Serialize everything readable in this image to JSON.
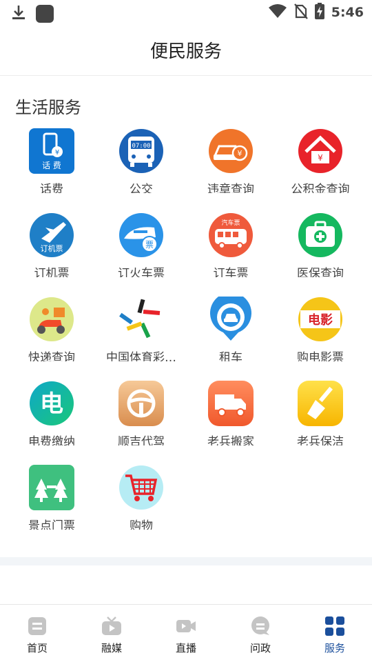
{
  "status_bar": {
    "time": "5:46"
  },
  "header": {
    "title": "便民服务"
  },
  "section": {
    "title": "生活服务"
  },
  "services": [
    {
      "label": "话费",
      "icon": "phone-bill-icon"
    },
    {
      "label": "公交",
      "icon": "bus-icon"
    },
    {
      "label": "违章查询",
      "icon": "traffic-violation-icon"
    },
    {
      "label": "公积金查询",
      "icon": "housing-fund-icon"
    },
    {
      "label": "订机票",
      "icon": "flight-ticket-icon"
    },
    {
      "label": "订火车票",
      "icon": "train-ticket-icon"
    },
    {
      "label": "订车票",
      "icon": "coach-ticket-icon"
    },
    {
      "label": "医保查询",
      "icon": "medical-insurance-icon"
    },
    {
      "label": "快递查询",
      "icon": "express-delivery-icon"
    },
    {
      "label": "中国体育彩…",
      "icon": "sports-lottery-icon"
    },
    {
      "label": "租车",
      "icon": "car-rental-icon"
    },
    {
      "label": "购电影票",
      "icon": "movie-ticket-icon"
    },
    {
      "label": "电费缴纳",
      "icon": "electricity-bill-icon"
    },
    {
      "label": "顺吉代驾",
      "icon": "designated-driver-icon"
    },
    {
      "label": "老兵搬家",
      "icon": "moving-truck-icon"
    },
    {
      "label": "老兵保洁",
      "icon": "cleaning-broom-icon"
    },
    {
      "label": "景点门票",
      "icon": "scenic-ticket-icon"
    },
    {
      "label": "购物",
      "icon": "shopping-cart-icon"
    }
  ],
  "icon_text": {
    "phone_bill": "话 费",
    "bus_display": "07:00",
    "flight": "订机票",
    "train": "票",
    "coach": "汽车票",
    "movie": "电影"
  },
  "bottom_nav": [
    {
      "label": "首页",
      "icon": "home-icon",
      "active": false
    },
    {
      "label": "融媒",
      "icon": "tv-icon",
      "active": false
    },
    {
      "label": "直播",
      "icon": "video-icon",
      "active": false
    },
    {
      "label": "问政",
      "icon": "chat-icon",
      "active": false
    },
    {
      "label": "服务",
      "icon": "grid-icon",
      "active": true
    }
  ],
  "colors": {
    "accent": "#1b4f9c",
    "nav_inactive": "#bfbfbf"
  }
}
